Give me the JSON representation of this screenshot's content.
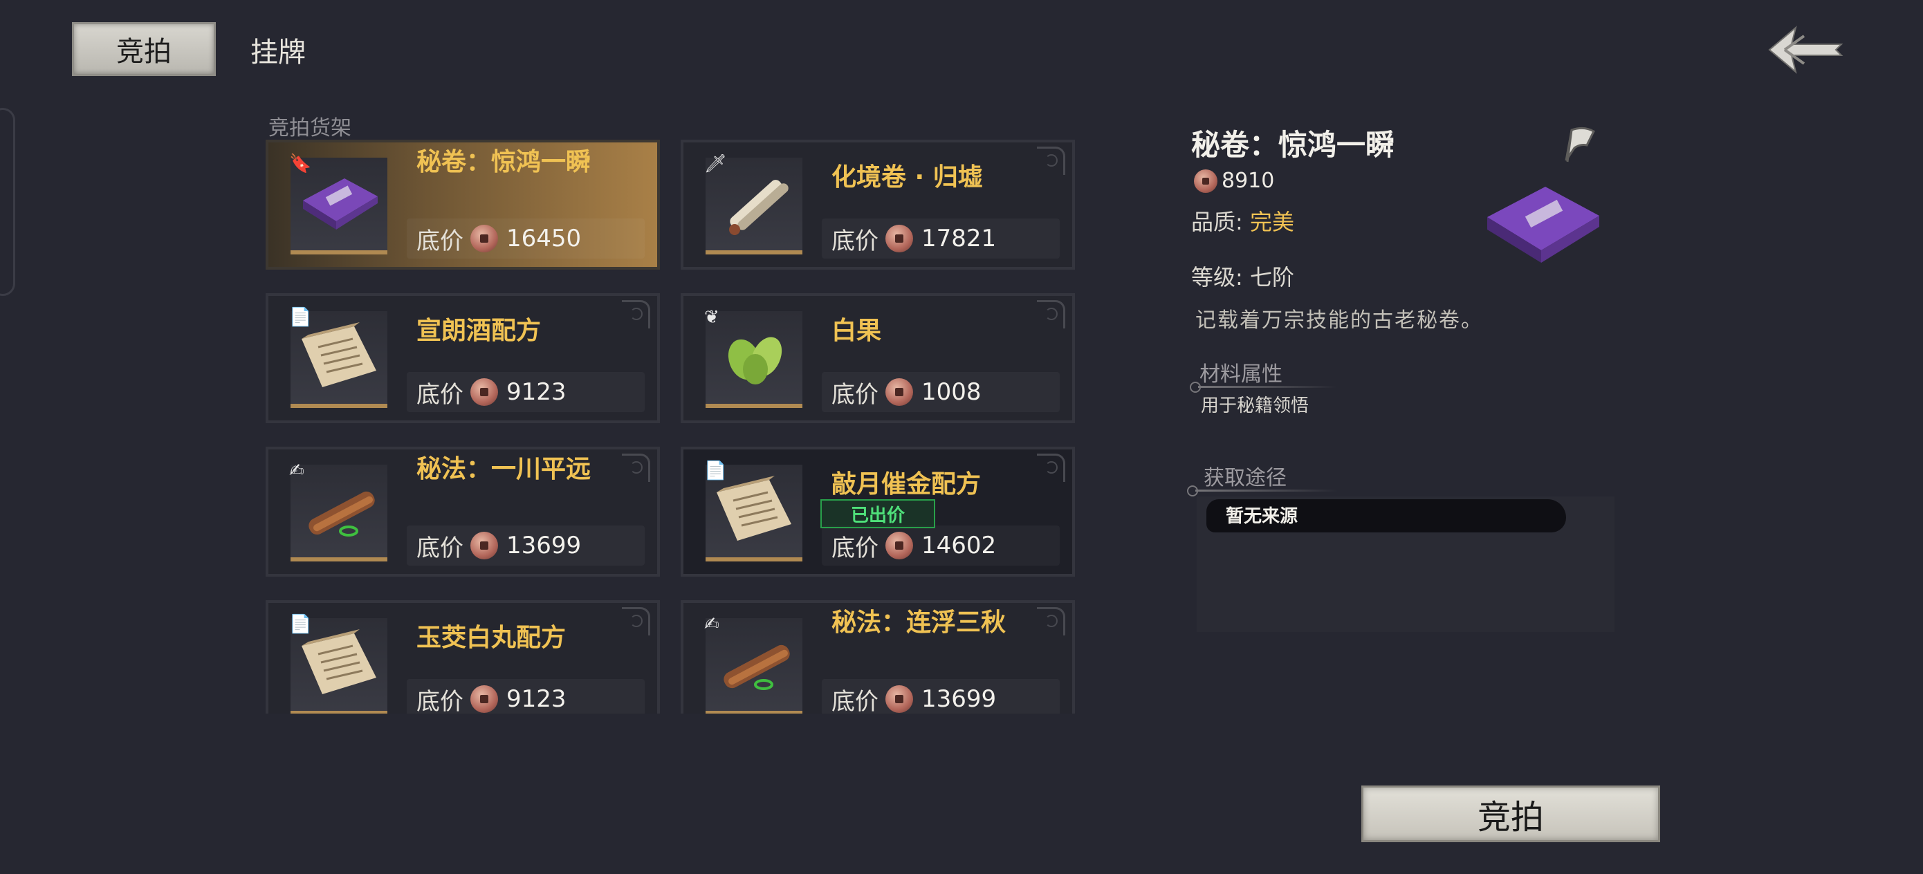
{
  "tabs": {
    "active": "竞拍",
    "other": "挂牌"
  },
  "shelf_title": "竞拍货架",
  "price_label": "底价",
  "bid_tag": "已出价",
  "items": [
    {
      "name": "秘卷：惊鸿一瞬",
      "price": "16450",
      "icon": "purple-book",
      "badge": "bookmark"
    },
    {
      "name": "化境卷 · 归墟",
      "price": "17821",
      "icon": "scroll-roll",
      "badge": "sword"
    },
    {
      "name": "宣朗酒配方",
      "price": "9123",
      "icon": "recipe-page",
      "badge": "paper"
    },
    {
      "name": "白果",
      "price": "1008",
      "icon": "green-herb",
      "badge": "herb"
    },
    {
      "name": "秘法：一川平远",
      "price": "13699",
      "icon": "brown-scroll",
      "badge": "technique"
    },
    {
      "name": "敲月催金配方",
      "price": "14602",
      "icon": "recipe-page",
      "badge": "paper"
    },
    {
      "name": "玉茭白丸配方",
      "price": "9123",
      "icon": "recipe-page",
      "badge": "paper"
    },
    {
      "name": "秘法：连浮三秋",
      "price": "13699",
      "icon": "brown-scroll",
      "badge": "technique"
    }
  ],
  "detail": {
    "title": "秘卷：惊鸿一瞬",
    "price": "8910",
    "quality_label": "品质:",
    "quality_value": "完美",
    "level": "等级: 七阶",
    "description": "记载着万宗技能的古老秘卷。",
    "material_head": "材料属性",
    "material_text": "用于秘籍领悟",
    "source_head": "获取途径",
    "source_text": "暂无来源"
  },
  "bid_button": "竞拍",
  "colors": {
    "gold_name": "#f0c253",
    "bid_green": "#4fe07a",
    "background": "#262731"
  }
}
